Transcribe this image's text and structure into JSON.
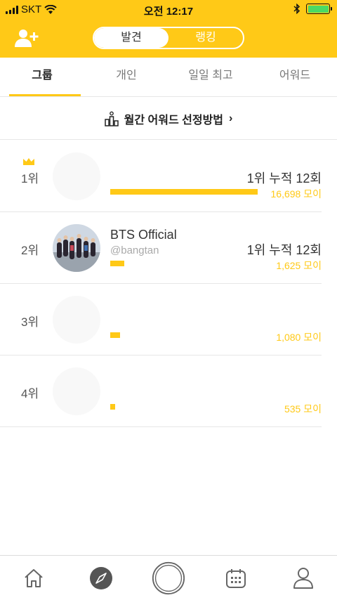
{
  "status_bar": {
    "carrier": "SKT",
    "time": "오전 12:17",
    "battery_color": "#4CD964"
  },
  "header": {
    "left_icon": "add-user-icon",
    "segments": [
      "발견",
      "랭킹"
    ],
    "selected_segment": "랭킹",
    "accent": "#FFC917"
  },
  "tabs": [
    {
      "label": "그룹",
      "active": true
    },
    {
      "label": "개인",
      "active": false
    },
    {
      "label": "일일 최고",
      "active": false
    },
    {
      "label": "어워드",
      "active": false
    }
  ],
  "award_banner": {
    "icon": "podium-icon",
    "label": "월간 어워드 선정방법",
    "chevron": "›"
  },
  "rankings": [
    {
      "rank": "1위",
      "crown": true,
      "name": "",
      "handle": "",
      "cumulative": "1위 누적 12회",
      "moi": "16,698 모이",
      "bar_fraction": 1.0
    },
    {
      "rank": "2위",
      "crown": false,
      "name": "BTS Official",
      "handle": "@bangtan",
      "cumulative": "1위 누적 12회",
      "moi": "1,625 모이",
      "bar_fraction": 0.097
    },
    {
      "rank": "3위",
      "crown": false,
      "name": "",
      "handle": "",
      "cumulative": "",
      "moi": "1,080 모이",
      "bar_fraction": 0.065
    },
    {
      "rank": "4위",
      "crown": false,
      "name": "",
      "handle": "",
      "cumulative": "",
      "moi": "535 모이",
      "bar_fraction": 0.032
    }
  ],
  "bottom_nav": [
    {
      "icon": "home-icon"
    },
    {
      "icon": "compass-icon",
      "active": true
    },
    {
      "icon": "record-button-icon"
    },
    {
      "icon": "calendar-icon"
    },
    {
      "icon": "profile-icon"
    }
  ]
}
